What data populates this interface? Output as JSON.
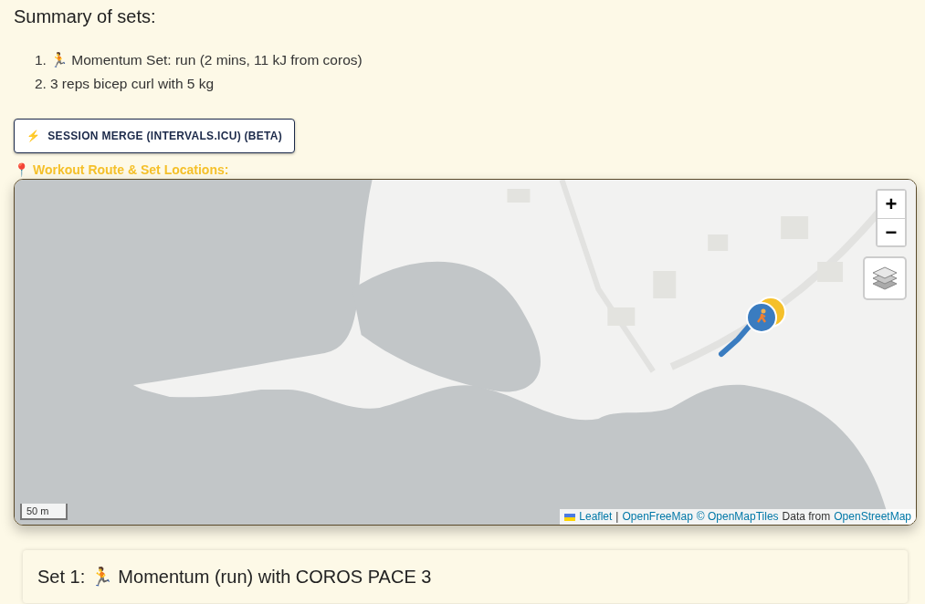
{
  "summary": {
    "title": "Summary of sets:",
    "items": [
      {
        "number": "1.",
        "text": "🏃 Momentum Set: run (2 mins, 11 kJ from coros)"
      },
      {
        "number": "2.",
        "text": "3 reps bicep curl with 5 kg"
      }
    ]
  },
  "merge_button": {
    "icon": "⚡",
    "label": "SESSION MERGE (INTERVALS.ICU) (BETA)"
  },
  "map_section": {
    "icon": "📍",
    "title": "Workout Route & Set Locations:"
  },
  "map": {
    "kind": "picture",
    "zoom_in": "+",
    "zoom_out": "−",
    "scale": "50 m",
    "attribution": [
      {
        "kind": "link",
        "text": "Leaflet",
        "flag": true
      },
      {
        "kind": "text",
        "text": "|"
      },
      {
        "kind": "link",
        "text": "OpenFreeMap"
      },
      {
        "kind": "link",
        "text": "© OpenMapTiles"
      },
      {
        "kind": "text",
        "text": "Data from"
      },
      {
        "kind": "link",
        "text": "OpenStreetMap"
      }
    ]
  },
  "set_card": {
    "title": "Set 1: 🏃 Momentum (run) with COROS PACE 3"
  }
}
